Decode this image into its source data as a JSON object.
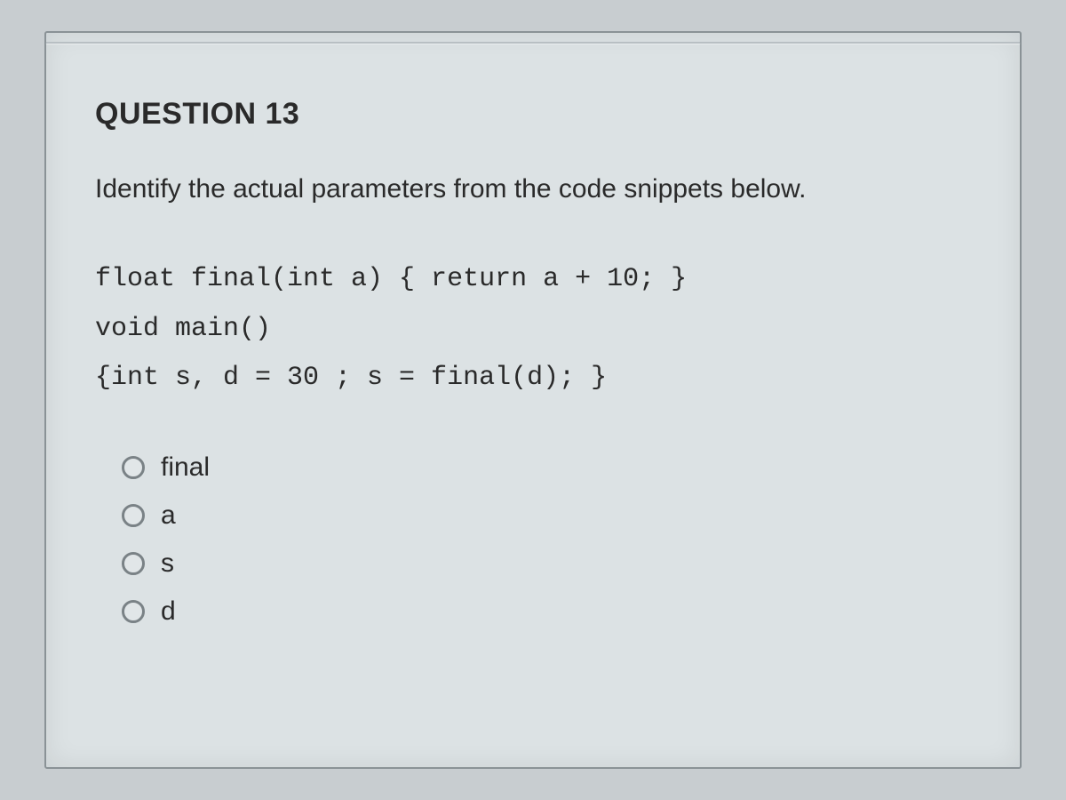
{
  "question": {
    "title": "QUESTION 13",
    "prompt": "Identify the actual parameters from the code snippets below.",
    "code_line_1": "float final(int a) { return a + 10; }",
    "code_line_2": "void main()",
    "code_line_3": "{int s, d = 30 ; s = final(d); }",
    "options": [
      {
        "label": "final"
      },
      {
        "label": "a"
      },
      {
        "label": "s"
      },
      {
        "label": "d"
      }
    ]
  }
}
